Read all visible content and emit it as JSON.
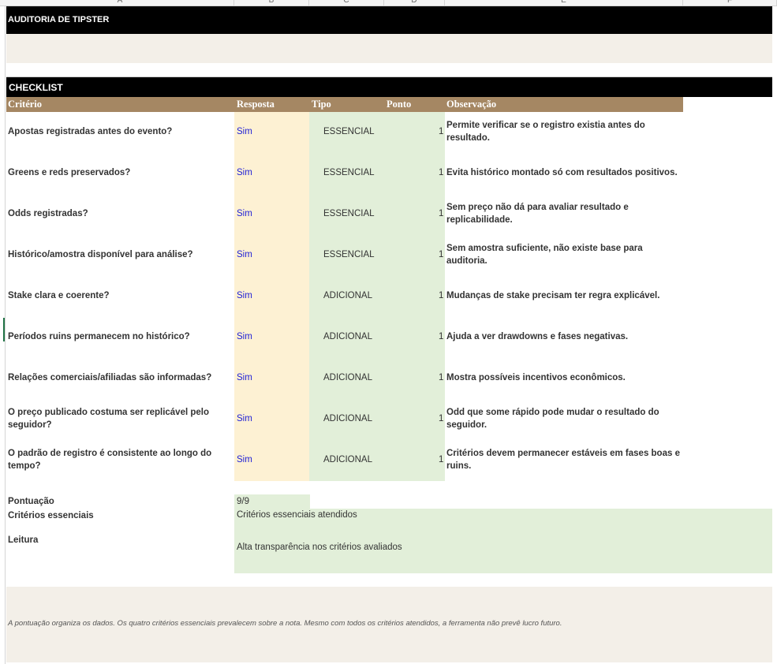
{
  "column_headers": [
    "A",
    "B",
    "C",
    "D",
    "E",
    "F"
  ],
  "title": "AUDITORIA DE TIPSTER",
  "checklist_title": "CHECKLIST",
  "table_headers": {
    "criterio": "Critério",
    "resposta": "Resposta",
    "tipo": "Tipo",
    "ponto": "Ponto",
    "observacao": "Observação"
  },
  "rows": [
    {
      "criterio": "Apostas registradas antes do evento?",
      "resposta": "Sim",
      "tipo": "ESSENCIAL",
      "ponto": "1",
      "observacao": "Permite verificar se o registro existia antes do resultado."
    },
    {
      "criterio": "Greens e reds preservados?",
      "resposta": "Sim",
      "tipo": "ESSENCIAL",
      "ponto": "1",
      "observacao": "Evita histórico montado só com resultados positivos."
    },
    {
      "criterio": "Odds registradas?",
      "resposta": "Sim",
      "tipo": "ESSENCIAL",
      "ponto": "1",
      "observacao": "Sem preço não dá para avaliar resultado e replicabilidade."
    },
    {
      "criterio": "Histórico/amostra disponível para análise?",
      "resposta": "Sim",
      "tipo": "ESSENCIAL",
      "ponto": "1",
      "observacao": "Sem amostra suficiente, não existe base para auditoria."
    },
    {
      "criterio": "Stake clara e coerente?",
      "resposta": "Sim",
      "tipo": "ADICIONAL",
      "ponto": "1",
      "observacao": "Mudanças de stake precisam ter regra explicável."
    },
    {
      "criterio": "Períodos ruins permanecem no histórico?",
      "resposta": "Sim",
      "tipo": "ADICIONAL",
      "ponto": "1",
      "observacao": "Ajuda a ver drawdowns e fases negativas."
    },
    {
      "criterio": "Relações comerciais/afiliadas são informadas?",
      "resposta": "Sim",
      "tipo": "ADICIONAL",
      "ponto": "1",
      "observacao": "Mostra possíveis incentivos econômicos."
    },
    {
      "criterio": "O preço publicado costuma ser replicável pelo seguidor?",
      "resposta": "Sim",
      "tipo": "ADICIONAL",
      "ponto": "1",
      "observacao": "Odd que some rápido pode mudar o resultado do seguidor."
    },
    {
      "criterio": "O padrão de registro é consistente ao longo do tempo?",
      "resposta": "Sim",
      "tipo": "ADICIONAL",
      "ponto": "1",
      "observacao": "Critérios devem permanecer estáveis em fases boas e ruins."
    }
  ],
  "summary": {
    "pontuacao_label": "Pontuação",
    "pontuacao_value": "9/9",
    "criterios_label": "Critérios essenciais",
    "criterios_value": "Critérios essenciais atendidos",
    "leitura_label": "Leitura",
    "leitura_value": "Alta transparência nos critérios avaliados"
  },
  "footer_note": "A pontuação organiza os dados. Os quatro critérios essenciais prevalecem sobre a nota. Mesmo com todos os critérios atendidos, a ferramenta não prevê lucro futuro.",
  "colors": {
    "header_brown": "#a58763",
    "resposta_bg": "#fdf1d3",
    "tipo_bg": "#e2efd9",
    "band_black": "#000000",
    "beige": "#f3efe8",
    "link_blue": "#1f1fd6"
  }
}
